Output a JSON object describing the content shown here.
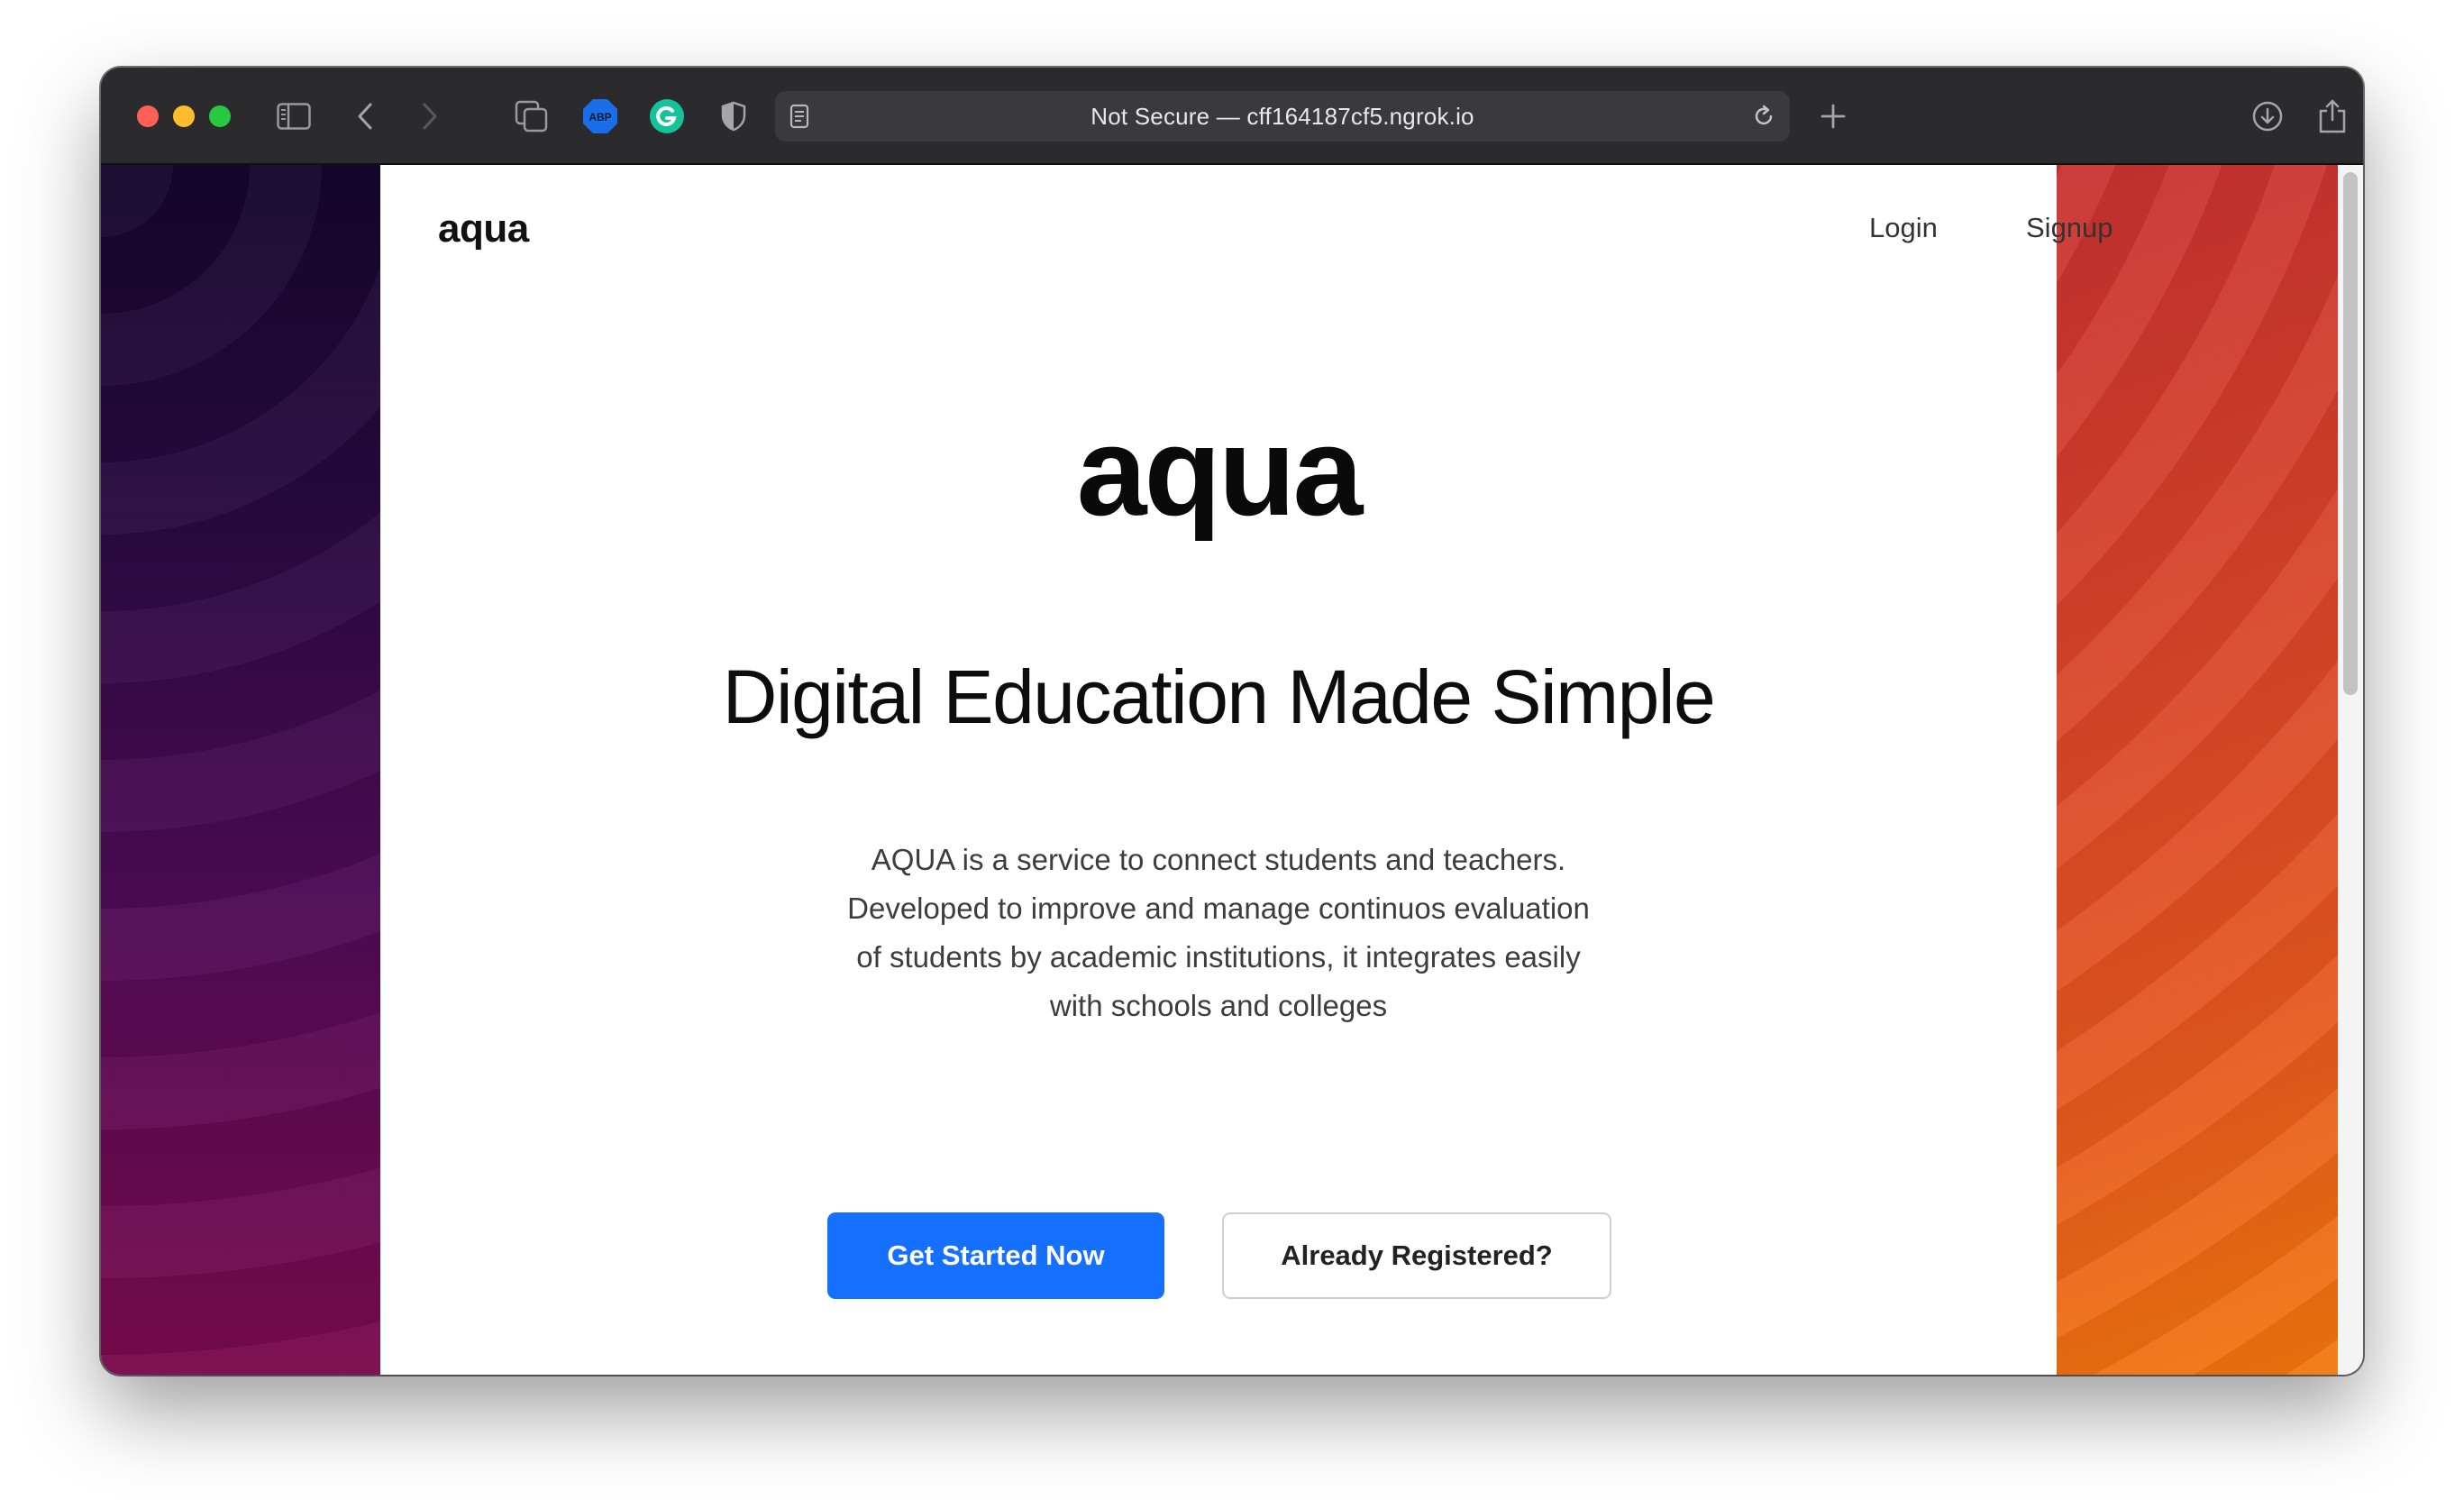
{
  "browser": {
    "address_text": "Not Secure — cff164187cf5.ngrok.io",
    "icons": [
      "sidebar-icon",
      "back-icon",
      "forward-icon",
      "tabs-overview-icon",
      "adblock-extension-icon",
      "grammarly-extension-icon",
      "privacy-shield-icon",
      "reader-icon",
      "reload-icon",
      "new-tab-icon",
      "downloads-icon",
      "share-icon"
    ],
    "extension_badge": "ABP"
  },
  "header": {
    "brand": "aqua",
    "nav": {
      "login": "Login",
      "signup": "Signup"
    }
  },
  "hero": {
    "title": "aqua",
    "subtitle": "Digital Education Made Simple",
    "description_lines": [
      "AQUA is a service to connect students and teachers.",
      "Developed to improve and manage continuos evaluation",
      "of students by academic institutions, it integrates easily",
      "with schools and colleges"
    ],
    "primary_button": "Get Started Now",
    "secondary_button": "Already Registered?"
  },
  "colors": {
    "primary": "#1570ff",
    "left_panel_gradient": [
      "#14062c",
      "#7a0a4d"
    ],
    "right_panel_gradient": [
      "#c8302f",
      "#f2780c"
    ]
  }
}
